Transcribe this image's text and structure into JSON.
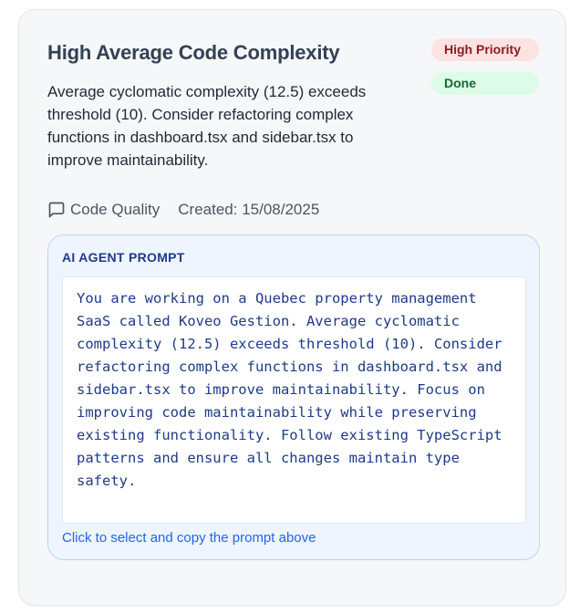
{
  "card": {
    "title": "High Average Code Complexity",
    "description": "Average cyclomatic complexity (12.5) exceeds threshold (10). Consider refactoring complex functions in dashboard.tsx and sidebar.tsx to improve maintainability.",
    "priority_badge": "High Priority",
    "status_badge": "Done",
    "category": "Code Quality",
    "category_icon": "message-square-icon",
    "created": "Created: 15/08/2025"
  },
  "prompt": {
    "heading": "AI AGENT PROMPT",
    "text": "You are working on a Quebec property management SaaS called Koveo Gestion. Average cyclomatic complexity (12.5) exceeds threshold (10). Consider refactoring complex functions in dashboard.tsx and sidebar.tsx to improve maintainability. Focus on improving code maintainability while preserving existing functionality. Follow existing TypeScript patterns and ensure all changes maintain type safety.",
    "hint": "Click to select and copy the prompt above"
  },
  "colors": {
    "title": "#334155",
    "priority_bg": "#fde2e2",
    "priority_fg": "#8b1c1c",
    "status_bg": "#dcfce7",
    "status_fg": "#166534",
    "prompt_bg": "#eef5ff",
    "prompt_fg": "#1e3a8a",
    "hint": "#2563eb"
  }
}
